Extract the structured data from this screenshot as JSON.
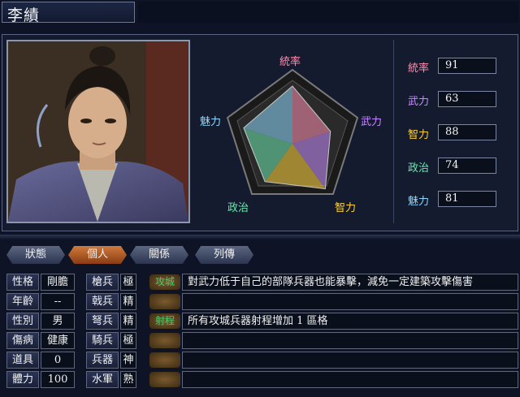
{
  "officer": {
    "name": "李績"
  },
  "radar": {
    "labels": {
      "command": "統率",
      "war": "武力",
      "intelligence": "智力",
      "politics": "政治",
      "charm": "魅力"
    },
    "colors": {
      "command": "#ff8fb0",
      "war": "#c68cff",
      "intelligence": "#ffd23a",
      "politics": "#6de8b0",
      "charm": "#8fd8ff"
    }
  },
  "stats": [
    {
      "label": "統率",
      "value": "91",
      "color": "#ff8fb0"
    },
    {
      "label": "武力",
      "value": "63",
      "color": "#c68cff"
    },
    {
      "label": "智力",
      "value": "88",
      "color": "#ffd23a"
    },
    {
      "label": "政治",
      "value": "74",
      "color": "#6de8b0"
    },
    {
      "label": "魅力",
      "value": "81",
      "color": "#8fd8ff"
    }
  ],
  "tabs": [
    {
      "label": "狀態",
      "active": false
    },
    {
      "label": "個人",
      "active": true
    },
    {
      "label": "關係",
      "active": false
    },
    {
      "label": "列傳",
      "active": false
    }
  ],
  "personal": [
    {
      "label": "性格",
      "value": "剛膽",
      "unit": "槍兵",
      "rank": "極",
      "skill": "攻城",
      "desc": "對武力低于自己的部隊兵器也能暴擊，減免一定建築攻擊傷害"
    },
    {
      "label": "年齡",
      "value": "--",
      "unit": "戟兵",
      "rank": "精",
      "skill": "",
      "desc": ""
    },
    {
      "label": "性別",
      "value": "男",
      "unit": "弩兵",
      "rank": "精",
      "skill": "射程",
      "desc": "所有攻城兵器射程增加 1 區格"
    },
    {
      "label": "傷病",
      "value": "健康",
      "unit": "騎兵",
      "rank": "極",
      "skill": "",
      "desc": ""
    },
    {
      "label": "道具",
      "value": "0",
      "unit": "兵器",
      "rank": "神",
      "skill": "",
      "desc": ""
    },
    {
      "label": "體力",
      "value": "100",
      "unit": "水軍",
      "rank": "熟",
      "skill": "",
      "desc": ""
    }
  ]
}
